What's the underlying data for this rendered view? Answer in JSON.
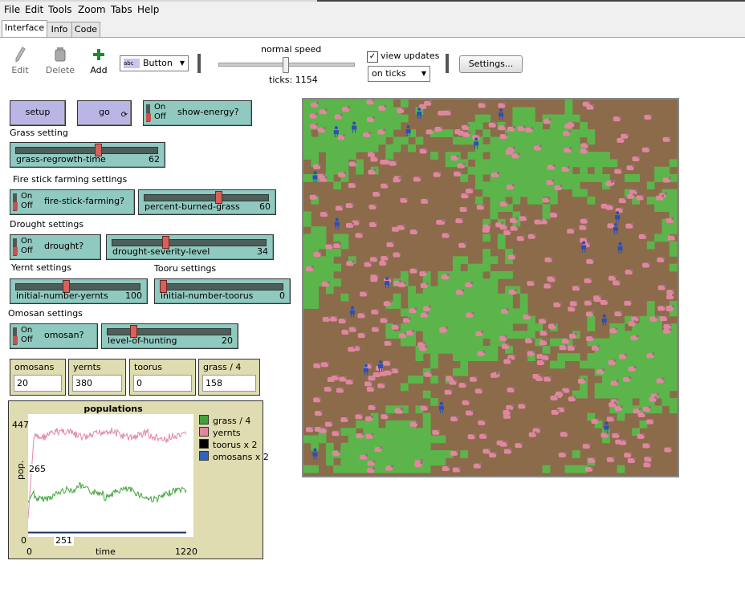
{
  "menu": [
    "File",
    "Edit",
    "Tools",
    "Zoom",
    "Tabs",
    "Help"
  ],
  "tabs": [
    "Interface",
    "Info",
    "Code"
  ],
  "toolbar": {
    "edit": "Edit",
    "delete": "Delete",
    "add": "Add",
    "widget_type": "Button",
    "speed_label": "normal speed",
    "ticks": "ticks: 1154",
    "view_updates": "view updates",
    "update_mode": "on ticks",
    "settings": "Settings..."
  },
  "widgets": {
    "setup": "setup",
    "go": "go",
    "on": "On",
    "off": "Off",
    "show_energy": "show-energy?",
    "grass_setting": "Grass setting",
    "grass_regrowth": {
      "name": "grass-regrowth-time",
      "value": "62",
      "fraction": 0.58
    },
    "fire_settings": "Fire stick farming settings",
    "fire_switch": "fire-stick-farming?",
    "percent_burned": {
      "name": "percent-burned-grass",
      "value": "60",
      "fraction": 0.6
    },
    "drought_settings": "Drought settings",
    "drought_switch": "drought?",
    "drought_level": {
      "name": "drought-severity-level",
      "value": "34",
      "fraction": 0.34
    },
    "yernt_settings": "Yernt settings",
    "tooru_settings": "Tooru settings",
    "init_yernts": {
      "name": "initial-number-yernts",
      "value": "100",
      "fraction": 0.4
    },
    "init_toorus": {
      "name": "initial-number-toorus",
      "value": "0",
      "fraction": 0.0
    },
    "omosan_settings": "Omosan settings",
    "omosan_switch": "omosan?",
    "hunting": {
      "name": "level-of-hunting",
      "value": "20",
      "fraction": 0.2
    }
  },
  "monitors": [
    {
      "name": "omosans",
      "value": "20"
    },
    {
      "name": "yernts",
      "value": "380"
    },
    {
      "name": "toorus",
      "value": "0"
    },
    {
      "name": "grass / 4",
      "value": "158"
    }
  ],
  "chart_data": {
    "type": "line",
    "title": "populations",
    "xlabel": "time",
    "ylabel": "pop.",
    "xlim": [
      0,
      1220
    ],
    "ylim": [
      0,
      447
    ],
    "x_labels": [
      "0",
      "251",
      "1220"
    ],
    "y_labels": [
      "447",
      "265",
      "0"
    ],
    "series": [
      {
        "name": "grass / 4",
        "color": "#3fa33a"
      },
      {
        "name": "yernts",
        "color": "#e087a0"
      },
      {
        "name": "toorus x 2",
        "color": "#000000"
      },
      {
        "name": "omosans x 2",
        "color": "#3660b8"
      }
    ]
  },
  "colors": {
    "grass": "#5cb54a",
    "dirt": "#8b6b4a",
    "yernt": "#e087a0",
    "omosan": "#2b4fb8"
  }
}
